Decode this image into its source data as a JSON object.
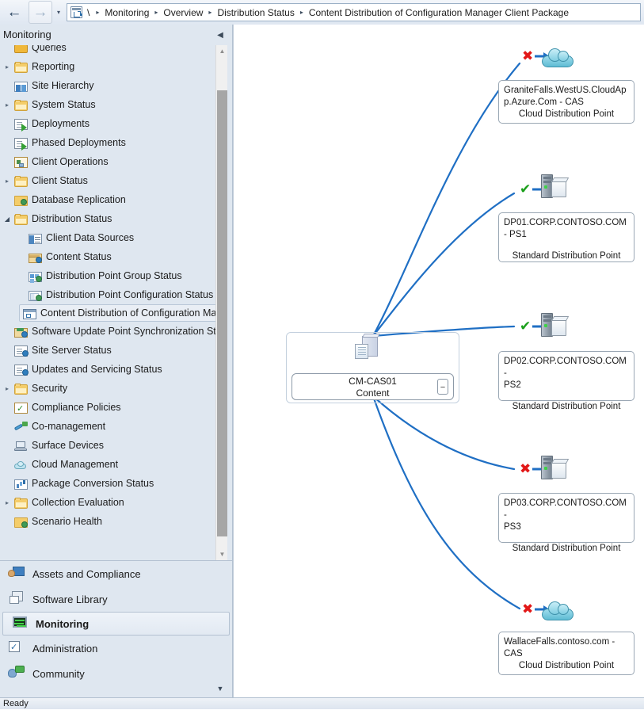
{
  "window": {
    "status_text": "Ready"
  },
  "navbar": {
    "back_label": "←",
    "forward_label": "→",
    "dropdown_label": "▾",
    "home_icon": "content-distribution-icon",
    "breadcrumbs": [
      {
        "label": "\\"
      },
      {
        "label": "Monitoring"
      },
      {
        "label": "Overview"
      },
      {
        "label": "Distribution Status"
      },
      {
        "label": "Content Distribution of Configuration Manager Client Package"
      }
    ],
    "separator": "▸"
  },
  "sidebar": {
    "title": "Monitoring",
    "collapse_label": "◀",
    "scroll_up": "▲",
    "scroll_down": "▼",
    "tree": [
      {
        "label": "Queries",
        "icon": "queries-icon",
        "expander": "",
        "indent": 1,
        "selected": false,
        "clipped": true
      },
      {
        "label": "Reporting",
        "icon": "folder-icon",
        "expander": "▸",
        "indent": 1,
        "selected": false
      },
      {
        "label": "Site Hierarchy",
        "icon": "site-hierarchy-icon",
        "expander": "",
        "indent": 1,
        "selected": false
      },
      {
        "label": "System Status",
        "icon": "folder-icon",
        "expander": "▸",
        "indent": 1,
        "selected": false
      },
      {
        "label": "Deployments",
        "icon": "deployments-icon",
        "expander": "",
        "indent": 1,
        "selected": false
      },
      {
        "label": "Phased Deployments",
        "icon": "deployments-icon",
        "expander": "",
        "indent": 1,
        "selected": false
      },
      {
        "label": "Client Operations",
        "icon": "client-operations-icon",
        "expander": "",
        "indent": 1,
        "selected": false
      },
      {
        "label": "Client Status",
        "icon": "folder-icon",
        "expander": "▸",
        "indent": 1,
        "selected": false
      },
      {
        "label": "Database Replication",
        "icon": "database-replication-icon",
        "expander": "",
        "indent": 1,
        "selected": false
      },
      {
        "label": "Distribution Status",
        "icon": "folder-icon",
        "expander": "◢",
        "indent": 1,
        "selected": false
      },
      {
        "label": "Client Data Sources",
        "icon": "client-data-sources-icon",
        "expander": "",
        "indent": 2,
        "selected": false
      },
      {
        "label": "Content Status",
        "icon": "content-status-icon",
        "expander": "",
        "indent": 2,
        "selected": false
      },
      {
        "label": "Distribution Point Group Status",
        "icon": "dp-group-status-icon",
        "expander": "",
        "indent": 2,
        "selected": false
      },
      {
        "label": "Distribution Point Configuration Status",
        "icon": "dp-config-status-icon",
        "expander": "",
        "indent": 2,
        "selected": false
      },
      {
        "label": "Content Distribution of Configuration Manager Client Package",
        "icon": "content-distribution-icon",
        "expander": "",
        "indent": 2,
        "selected": true
      },
      {
        "label": "Software Update Point Synchronization Status",
        "icon": "sync-status-icon",
        "expander": "",
        "indent": 1,
        "selected": false
      },
      {
        "label": "Site Server Status",
        "icon": "site-server-status-icon",
        "expander": "",
        "indent": 1,
        "selected": false
      },
      {
        "label": "Updates and Servicing Status",
        "icon": "updates-servicing-icon",
        "expander": "",
        "indent": 1,
        "selected": false
      },
      {
        "label": "Security",
        "icon": "folder-icon",
        "expander": "▸",
        "indent": 1,
        "selected": false
      },
      {
        "label": "Compliance Policies",
        "icon": "compliance-policies-icon",
        "expander": "",
        "indent": 1,
        "selected": false
      },
      {
        "label": "Co-management",
        "icon": "co-management-icon",
        "expander": "",
        "indent": 1,
        "selected": false
      },
      {
        "label": "Surface Devices",
        "icon": "surface-devices-icon",
        "expander": "",
        "indent": 1,
        "selected": false
      },
      {
        "label": "Cloud Management",
        "icon": "cloud-icon",
        "expander": "",
        "indent": 1,
        "selected": false
      },
      {
        "label": "Package Conversion Status",
        "icon": "package-conversion-icon",
        "expander": "",
        "indent": 1,
        "selected": false
      },
      {
        "label": "Collection Evaluation",
        "icon": "folder-icon",
        "expander": "▸",
        "indent": 1,
        "selected": false
      },
      {
        "label": "Scenario Health",
        "icon": "scenario-health-icon",
        "expander": "",
        "indent": 1,
        "selected": false
      }
    ],
    "workspaces": [
      {
        "label": "Assets and Compliance",
        "icon": "assets-compliance-icon",
        "active": false
      },
      {
        "label": "Software Library",
        "icon": "software-library-icon",
        "active": false
      },
      {
        "label": "Monitoring",
        "icon": "monitoring-icon",
        "active": true
      },
      {
        "label": "Administration",
        "icon": "administration-icon",
        "active": false
      },
      {
        "label": "Community",
        "icon": "community-icon",
        "active": false
      }
    ],
    "more_label": "▼"
  },
  "diagram": {
    "center": {
      "name": "CM-CAS01",
      "content_label": "Content",
      "collapse_label": "−",
      "icon": "package-icon"
    },
    "status_arrow": "➜",
    "status_fail_glyph": "✖",
    "status_ok_glyph": "✔",
    "colors": {
      "edge": "#1f6fc4",
      "fail": "#e21818",
      "ok": "#1a9f1a",
      "arrow": "#1f6fc4"
    },
    "targets": [
      {
        "host_line1": "GraniteFalls.WestUS.CloudAp",
        "host_line2": "p.Azure.Com - CAS",
        "role": "Cloud Distribution Point",
        "status": "fail",
        "icon": "cloud-distribution-point-icon"
      },
      {
        "host_line1": "DP01.CORP.CONTOSO.COM",
        "host_line2": "- PS1",
        "role": "Standard Distribution Point",
        "status": "ok",
        "icon": "standard-distribution-point-icon"
      },
      {
        "host_line1": "DP02.CORP.CONTOSO.COM -",
        "host_line2": "PS2",
        "role": "Standard Distribution Point",
        "status": "ok",
        "icon": "standard-distribution-point-icon"
      },
      {
        "host_line1": "DP03.CORP.CONTOSO.COM -",
        "host_line2": "PS3",
        "role": "Standard Distribution Point",
        "status": "fail",
        "icon": "standard-distribution-point-icon"
      },
      {
        "host_line1": "WallaceFalls.contoso.com -",
        "host_line2": "CAS",
        "role": "Cloud Distribution Point",
        "status": "fail",
        "icon": "cloud-distribution-point-icon"
      }
    ]
  }
}
